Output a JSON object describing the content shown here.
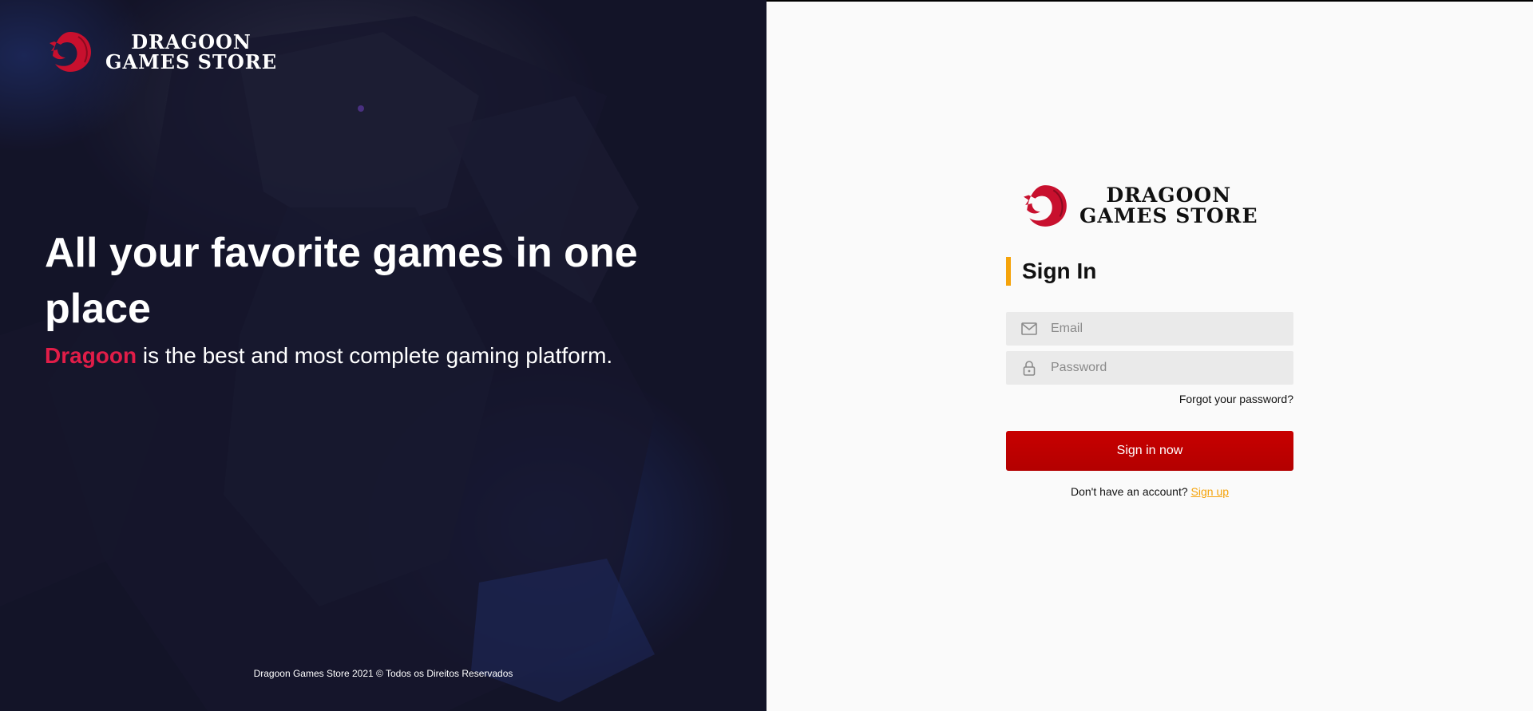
{
  "brand": {
    "logo_line1": "DRAGOON",
    "logo_line2": "GAMES STORE",
    "accent_color": "#e11d48",
    "highlight_color": "#f5a30a",
    "button_color": "#c80000"
  },
  "hero": {
    "headline": "All your favorite games in one place",
    "sub_brand": "Dragoon",
    "sub_rest": " is the best and most complete gaming platform.",
    "footer": "Dragoon Games Store 2021 © Todos os Direitos Reservados"
  },
  "form": {
    "title": "Sign In",
    "email_placeholder": "Email",
    "password_placeholder": "Password",
    "forgot_label": "Forgot your password?",
    "submit_label": "Sign in now",
    "no_account_text": "Don't have an account? ",
    "signup_label": "Sign up",
    "email_icon": "mail-icon",
    "password_icon": "lock-icon"
  }
}
